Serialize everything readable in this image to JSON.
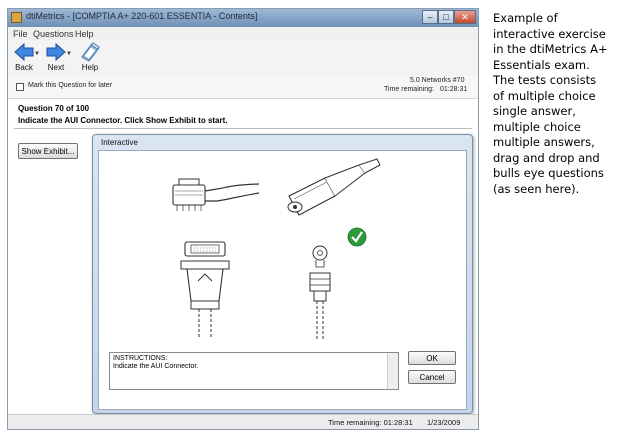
{
  "window": {
    "title": "dtiMetrics - [COMPTIA A+ 220-601 ESSENTIA - Contents]",
    "minimize_glyph": "–",
    "maximize_glyph": "□",
    "close_glyph": "✕"
  },
  "menu": [
    "File",
    "Questions",
    "Help"
  ],
  "toolbar": {
    "back_label": "Back",
    "next_label": "Next",
    "help_label": "Help",
    "icons": {
      "back": "back-arrow-icon",
      "next": "next-arrow-icon",
      "help": "help-book-icon"
    }
  },
  "info": {
    "mark_label": "Mark this Question for later",
    "mark_checked": false,
    "section": "5.0 Networks #70",
    "time_label": "Time remaining:",
    "time_value": "01:28:31"
  },
  "question": {
    "header": "Question 70 of 100",
    "text": "Indicate the AUI Connector. Click Show Exhibit to start.",
    "exhibit_button": "Show Exhibit..."
  },
  "dialog": {
    "title": "Interactive",
    "connectors": [
      "rj45-connector",
      "fiber-connector",
      "aui-connector",
      "bnc-connector"
    ],
    "selected_marker": "checkmark-icon",
    "instructions_line1": "INSTRUCTIONS:",
    "instructions_line2": "Indicate the AUI Connector.",
    "ok_label": "OK",
    "cancel_label": "Cancel"
  },
  "status": {
    "time_text": "Time remaining: 01:28:31",
    "date_text": "1/23/2009"
  },
  "caption": {
    "lines": [
      "Example of",
      "interactive exercise",
      "in the dtiMetrics A+",
      "Essentials exam.",
      "The tests consists",
      "of multiple choice",
      "single answer,",
      "multiple choice",
      "multiple answers,",
      "drag and drop and",
      "bulls eye questions",
      "(as seen here)."
    ]
  },
  "colors": {
    "titlebar": "#7f9fc6",
    "accent_blue": "#2f6fd0",
    "check_green": "#2e9b3a"
  }
}
